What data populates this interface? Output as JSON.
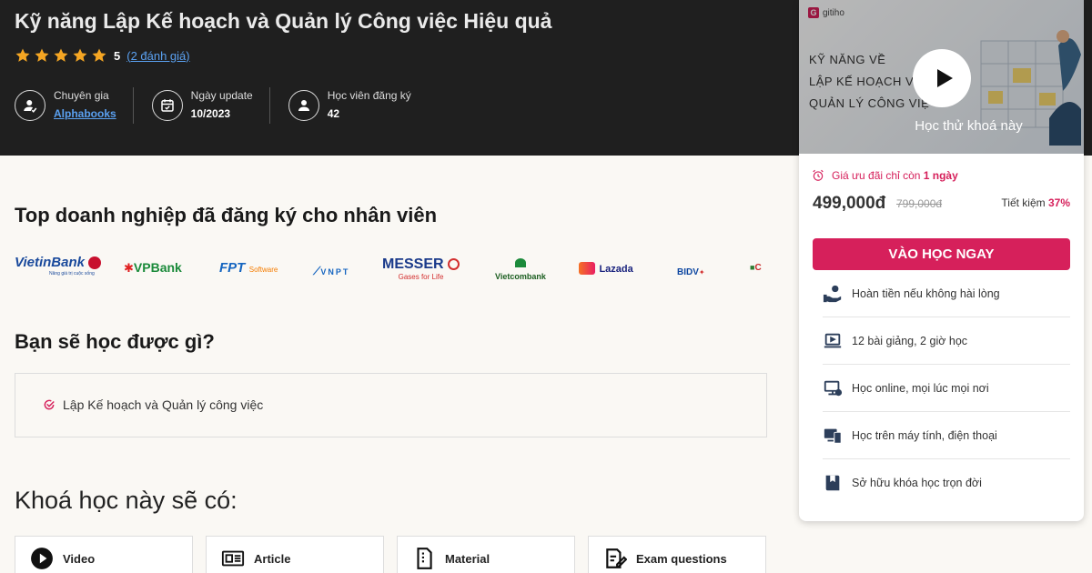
{
  "header": {
    "title": "Kỹ năng Lập Kế hoạch và Quản lý Công việc Hiệu quả",
    "rating": {
      "value": "5",
      "stars": 5,
      "reviews_link": "(2 đánh giá)"
    },
    "meta": [
      {
        "label": "Chuyên gia",
        "value": "Alphabooks",
        "icon": "expert-icon"
      },
      {
        "label": "Ngày update",
        "value": "10/2023",
        "icon": "calendar-icon"
      },
      {
        "label": "Học viên đăng ký",
        "value": "42",
        "icon": "students-icon"
      }
    ]
  },
  "companies": {
    "title": "Top doanh nghiệp đã đăng ký cho nhân viên",
    "logos": [
      {
        "name": "VietinBank",
        "tagline": "Nâng giá trị cuộc sống"
      },
      {
        "name": "VPBank"
      },
      {
        "name": "FPT",
        "suffix": "Software"
      },
      {
        "name": "VNPT"
      },
      {
        "name": "MESSER",
        "tagline": "Gases for Life"
      },
      {
        "name": "Vietcombank"
      },
      {
        "name": "Lazada"
      },
      {
        "name": "BIDV"
      },
      {
        "name": "C"
      }
    ]
  },
  "learn": {
    "title": "Bạn sẽ học được gì?",
    "items": [
      "Lập Kế hoạch và Quản lý công việc"
    ]
  },
  "includes": {
    "title": "Khoá học này sẽ có:",
    "items": [
      {
        "label": "Video",
        "icon": "video-icon"
      },
      {
        "label": "Article",
        "icon": "article-icon"
      },
      {
        "label": "Material",
        "icon": "material-icon"
      },
      {
        "label": "Exam questions",
        "icon": "exam-icon"
      }
    ]
  },
  "card": {
    "brand": "gitiho",
    "thumbnail_lines": [
      "KỸ NĂNG VỀ",
      "LẬP KẾ HOẠCH V",
      "QUẢN LÝ CÔNG VIỆ"
    ],
    "preview_label": "Học thử khoá này",
    "promo_prefix": "Giá ưu đãi chỉ còn ",
    "promo_days": "1 ngày",
    "price": "499,000đ",
    "old_price": "799,000đ",
    "save_prefix": "Tiết kiệm ",
    "save_percent": "37%",
    "cta": "VÀO HỌC NGAY",
    "benefits": [
      {
        "label": "Hoàn tiền nếu không hài lòng",
        "icon": "refund-icon"
      },
      {
        "label": "12 bài giảng, 2 giờ học",
        "icon": "laptop-icon"
      },
      {
        "label": "Học online, mọi lúc mọi nơi",
        "icon": "online-icon"
      },
      {
        "label": "Học trên máy tính, điện thoại",
        "icon": "devices-icon"
      },
      {
        "label": "Sở hữu khóa học trọn đời",
        "icon": "lifetime-icon"
      }
    ]
  },
  "colors": {
    "accent": "#d6205b",
    "hero_bg": "#1f1f1f",
    "link": "#5aa0f0",
    "star": "#f5a623",
    "page_bg": "#faf8f4"
  }
}
